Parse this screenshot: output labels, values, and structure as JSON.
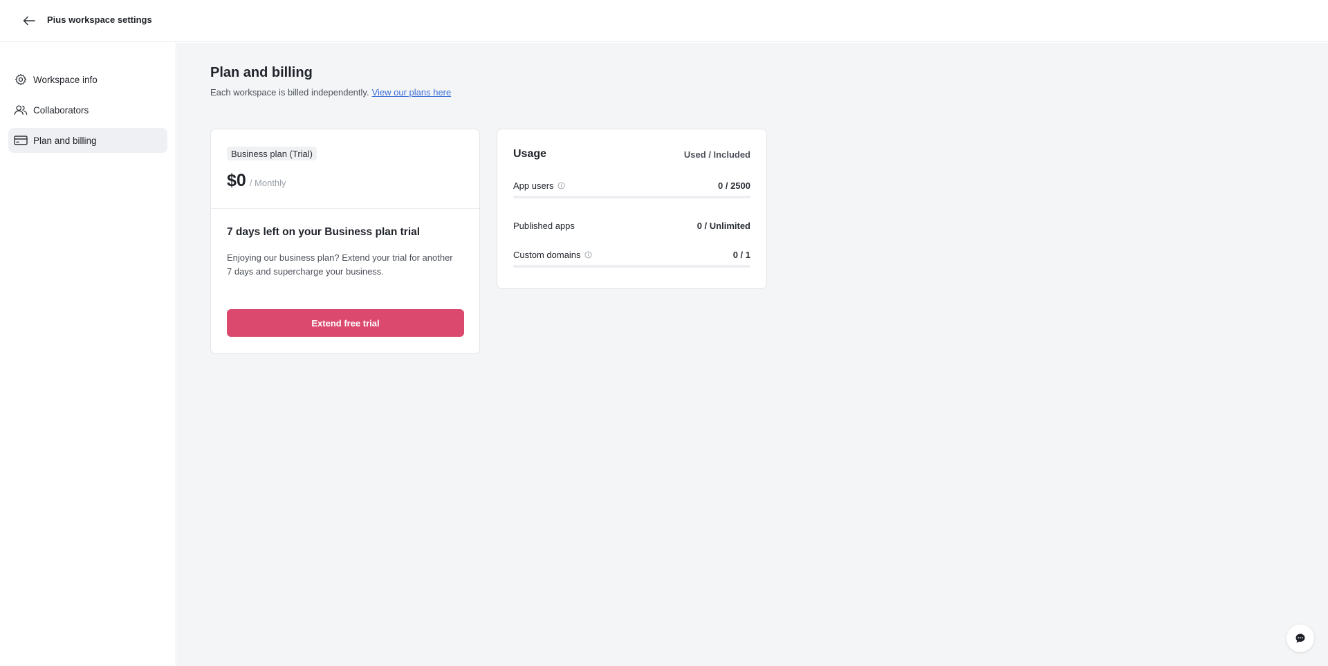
{
  "topbar": {
    "title": "Pius workspace settings"
  },
  "sidebar": {
    "items": [
      {
        "label": "Workspace info",
        "icon": "gear-icon",
        "active": false
      },
      {
        "label": "Collaborators",
        "icon": "users-icon",
        "active": false
      },
      {
        "label": "Plan and billing",
        "icon": "credit-card-icon",
        "active": true
      }
    ]
  },
  "main": {
    "title": "Plan and billing",
    "subtitle": "Each workspace is billed independently.",
    "plans_link": "View our plans here"
  },
  "plan_card": {
    "badge": "Business plan (Trial)",
    "price": "$0",
    "period": "/ Monthly",
    "trial_title": "7 days left on your Business plan trial",
    "trial_desc": "Enjoying our business plan? Extend your trial for another 7 days and supercharge your business.",
    "button_label": "Extend free trial",
    "button_color": "#db4a6e"
  },
  "usage_card": {
    "title": "Usage",
    "header_right": "Used / Included",
    "rows": [
      {
        "label": "App users",
        "value": "0 / 2500",
        "has_info": true,
        "has_bar": true,
        "fraction": 0
      },
      {
        "label": "Published apps",
        "value": "0 / Unlimited",
        "has_info": false,
        "has_bar": false
      },
      {
        "label": "Custom domains",
        "value": "0 / 1",
        "has_info": true,
        "has_bar": true,
        "fraction": 0
      }
    ]
  }
}
